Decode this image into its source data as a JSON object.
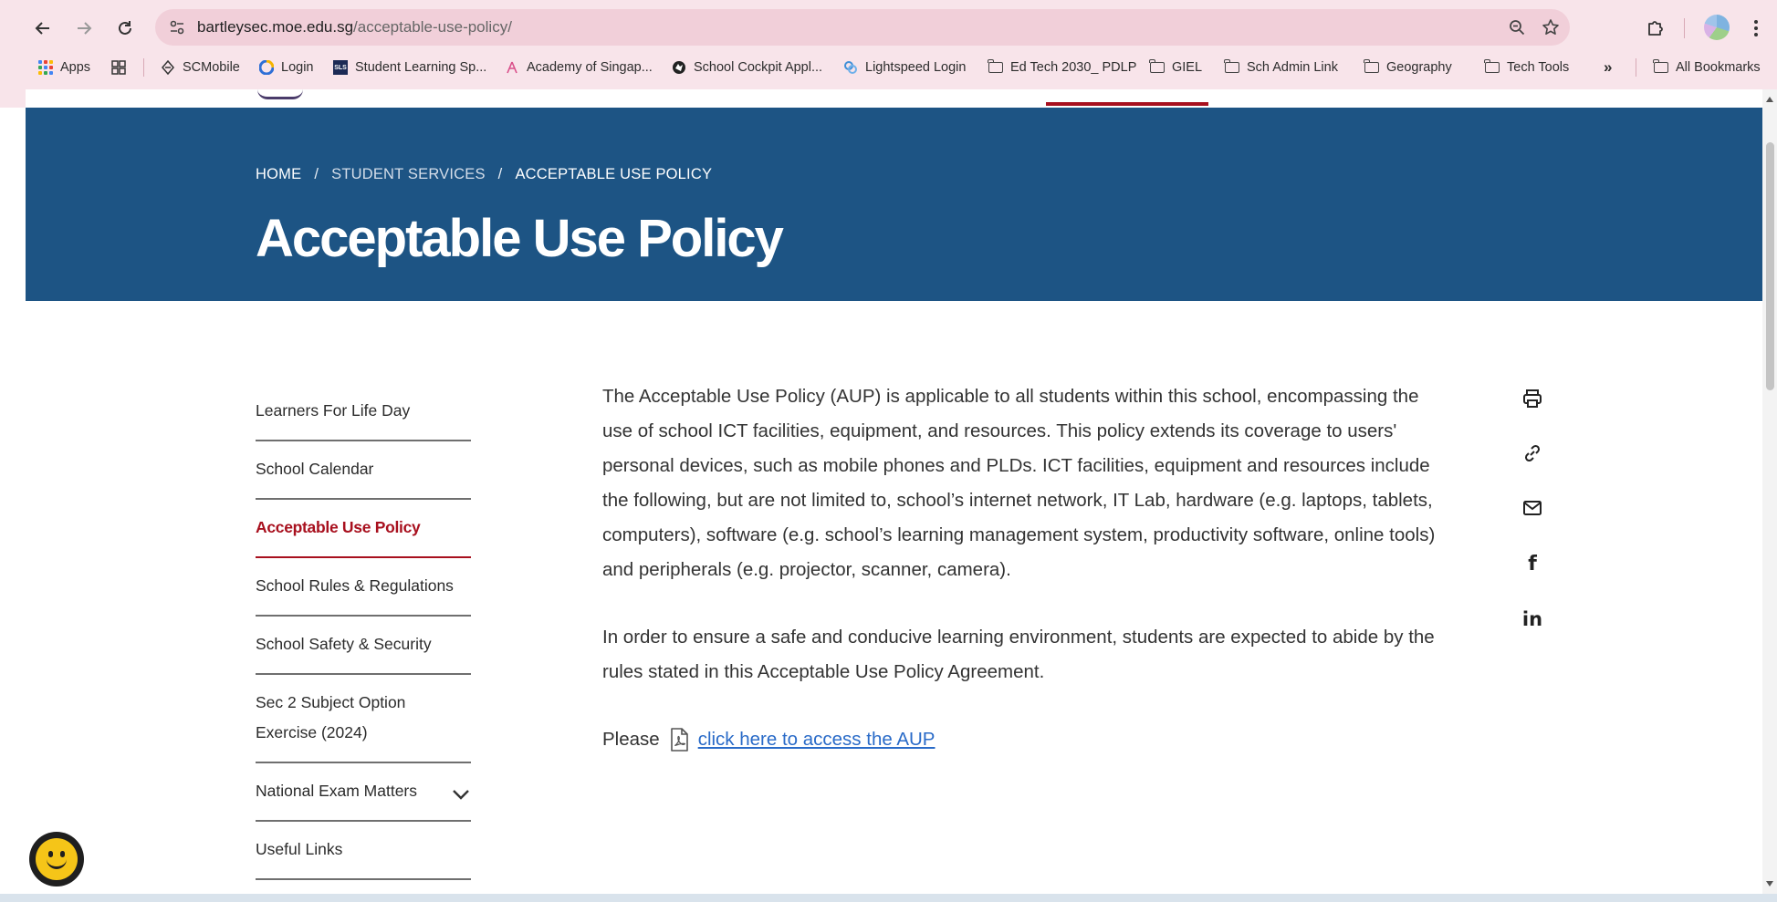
{
  "browser": {
    "url_host": "bartleysec.moe.edu.sg",
    "url_path": "/acceptable-use-policy/",
    "bookmarks": [
      {
        "label": "Apps",
        "icon": "apps-grid-icon"
      },
      {
        "label": "",
        "icon": "tab-groups-icon"
      },
      {
        "label": "SCMobile",
        "icon": "scmobile-icon"
      },
      {
        "label": "Login",
        "icon": "login-logo-icon"
      },
      {
        "label": "Student Learning Sp...",
        "icon": "sls-logo-icon"
      },
      {
        "label": "Academy of Singap...",
        "icon": "academy-logo-icon"
      },
      {
        "label": "School Cockpit Appl...",
        "icon": "cockpit-logo-icon"
      },
      {
        "label": "Lightspeed Login",
        "icon": "lightspeed-logo-icon"
      },
      {
        "label": "Ed Tech 2030_ PDLP",
        "icon": "folder-icon"
      },
      {
        "label": "GIEL",
        "icon": "folder-icon"
      },
      {
        "label": "Sch Admin Link",
        "icon": "folder-icon"
      },
      {
        "label": "Geography",
        "icon": "folder-icon"
      },
      {
        "label": "Tech Tools",
        "icon": "folder-icon"
      },
      {
        "label": "»",
        "icon": "more-bookmarks-icon"
      },
      {
        "label": "All Bookmarks",
        "icon": "folder-icon"
      }
    ]
  },
  "breadcrumb": {
    "home": "HOME",
    "sep": "/",
    "section": "STUDENT SERVICES",
    "current": "ACCEPTABLE USE POLICY"
  },
  "page_title": "Acceptable Use Policy",
  "sidenav": [
    {
      "label": "Learners For Life Day",
      "active": false
    },
    {
      "label": "School Calendar",
      "active": false
    },
    {
      "label": "Acceptable Use Policy",
      "active": true
    },
    {
      "label": "School Rules & Regulations",
      "active": false
    },
    {
      "label": "School Safety & Security",
      "active": false
    },
    {
      "label": "Sec 2 Subject Option Exercise (2024)",
      "active": false
    },
    {
      "label": "National Exam Matters",
      "active": false,
      "expandable": true
    },
    {
      "label": "Useful Links",
      "active": false
    }
  ],
  "content": {
    "paragraph1": "The Acceptable Use Policy (AUP) is applicable to all students within this school, encompassing the use of school ICT facilities, equipment, and resources. This policy extends its coverage to users' personal devices, such as mobile phones and PLDs. ICT facilities, equipment and resources include the following, but are not limited to, school’s internet network, IT Lab, hardware (e.g. laptops, tablets, computers), software (e.g. school’s learning management system, productivity software, online tools) and peripherals (e.g. projector, scanner, camera).",
    "paragraph2": " In order to ensure a safe and conducive learning environment, students are expected to abide by the rules stated in this Acceptable Use Policy Agreement.",
    "please": "Please",
    "aup_link": "click here to access the AUP"
  },
  "share": [
    "print-icon",
    "copy-link-icon",
    "email-icon",
    "facebook-icon",
    "linkedin-icon"
  ],
  "share_labels": {
    "facebook": "f",
    "linkedin": "in"
  },
  "colors": {
    "hero_bg": "#1d5484",
    "active_red": "#a8101e",
    "link_blue": "#2a6bc8",
    "chrome_bg": "#f8e4ea"
  }
}
